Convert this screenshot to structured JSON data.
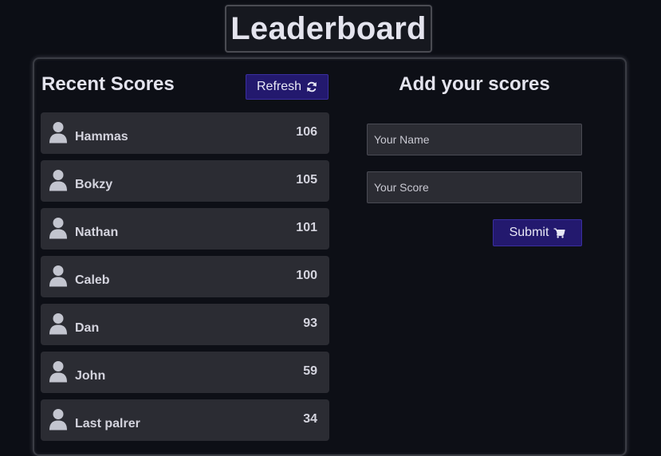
{
  "header": {
    "title": "Leaderboard"
  },
  "recent": {
    "title": "Recent Scores",
    "refresh_label": "Refresh",
    "refresh_icon": "refresh-icon",
    "entries": [
      {
        "name": "Hammas",
        "score": "106",
        "icon": "user-icon"
      },
      {
        "name": "Bokzy",
        "score": "105",
        "icon": "user-icon"
      },
      {
        "name": "Nathan",
        "score": "101",
        "icon": "user-icon"
      },
      {
        "name": "Caleb",
        "score": "100",
        "icon": "user-icon"
      },
      {
        "name": "Dan",
        "score": "93",
        "icon": "user-icon"
      },
      {
        "name": "John",
        "score": "59",
        "icon": "user-icon"
      },
      {
        "name": "Last palrer",
        "score": "34",
        "icon": "user-icon"
      }
    ]
  },
  "form": {
    "title": "Add your scores",
    "name_placeholder": "Your Name",
    "name_value": "",
    "score_placeholder": "Your Score",
    "score_value": "",
    "submit_label": "Submit",
    "submit_icon": "cart-icon"
  },
  "colors": {
    "background": "#0c0e15",
    "row": "#2b2c33",
    "button": "#23196e",
    "text": "#dcdce6"
  }
}
